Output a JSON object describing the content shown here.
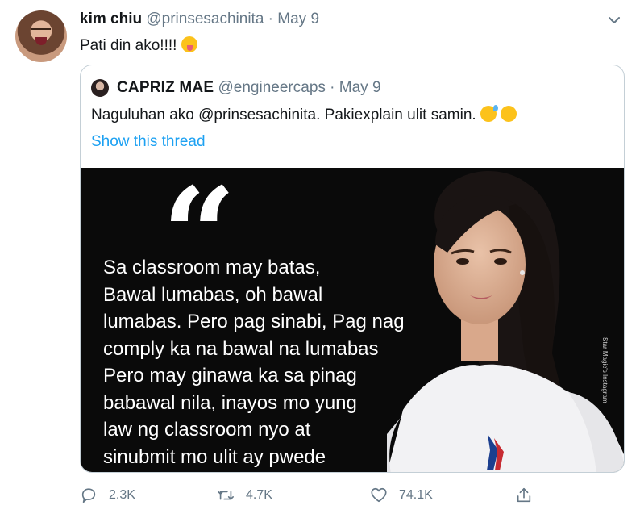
{
  "tweet": {
    "author_name": "kim chiu",
    "handle": "@prinsesachinita",
    "separator": "·",
    "date": "May 9",
    "text": "Pati din ako!!!!"
  },
  "quoted": {
    "author_name": "CAPRIZ MAE",
    "handle": "@engineercaps",
    "separator": "·",
    "date": "May 9",
    "text": "Naguluhan ako @prinsesachinita. Pakiexplain ulit samin.",
    "show_thread": "Show this thread",
    "image": {
      "quote_mark": "“",
      "lines": [
        "Sa classroom may batas,",
        "Bawal lumabas, oh bawal",
        "lumabas. Pero pag sinabi, Pag nag",
        "comply ka na bawal na lumabas",
        "Pero may ginawa ka sa pinag",
        "babawal nila, inayos mo yung",
        "law ng classroom nyo at",
        "sinubmit mo ulit ay pwede"
      ],
      "credit": "Star Magic's Instagram"
    }
  },
  "actions": {
    "reply_count": "2.3K",
    "retweet_count": "4.7K",
    "like_count": "74.1K"
  },
  "colors": {
    "link": "#1da1f2",
    "muted": "#657786",
    "border": "#c4cfd6"
  },
  "icons": [
    "caret-down-icon",
    "reply-icon",
    "retweet-icon",
    "like-icon",
    "share-icon"
  ]
}
